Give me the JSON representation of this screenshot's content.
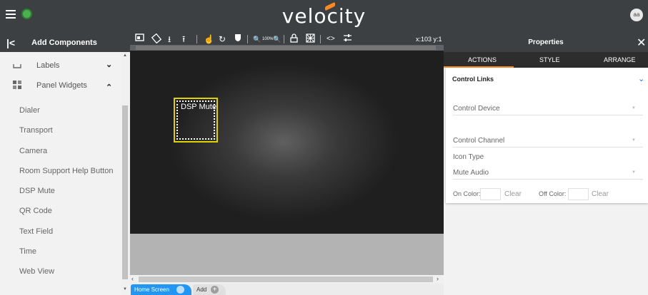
{
  "app": {
    "logo": "velocity",
    "avatar_initials": "aa"
  },
  "left_panel": {
    "title": "Add Components",
    "groups": [
      {
        "label": "Labels",
        "chevron": "⌄"
      },
      {
        "label": "Panel Widgets",
        "chevron": "⌃"
      }
    ],
    "widgets": [
      "Dialer",
      "Transport",
      "Camera",
      "Room Support Help Button",
      "DSP Mute",
      "QR Code",
      "Text Field",
      "Time",
      "Web View"
    ]
  },
  "toolbar": {
    "icons": [
      "screen-icon",
      "rotate-icon",
      "download-icon",
      "upload-icon",
      "touch-icon",
      "refresh-icon",
      "shield-icon",
      "zoom-out-icon",
      "zoom-in-icon",
      "lock-icon",
      "grid-icon",
      "code-icon",
      "sliders-icon"
    ],
    "zoom_level": "100%",
    "coords": "x:103 y:1"
  },
  "canvas": {
    "widget_label": "DSP Mute"
  },
  "tabs": {
    "home": "Home Screen",
    "add": "Add"
  },
  "properties": {
    "title": "Properties",
    "tabs": [
      "ACTIONS",
      "STYLE",
      "ARRANGE"
    ],
    "active_tab": "ACTIONS",
    "section": "Control Links",
    "control_device_label": "Control Device",
    "control_channel_label": "Control Channel",
    "icon_type_label": "Icon Type",
    "icon_type_value": "Mute Audio",
    "on_color_label": "On Color:",
    "off_color_label": "Off Color:",
    "clear_label": "Clear"
  },
  "colors": {
    "dark": "#3c4043",
    "accent_orange": "#ff8a1f",
    "tab_blue": "#2196f3",
    "selection_yellow": "#e2d100"
  }
}
